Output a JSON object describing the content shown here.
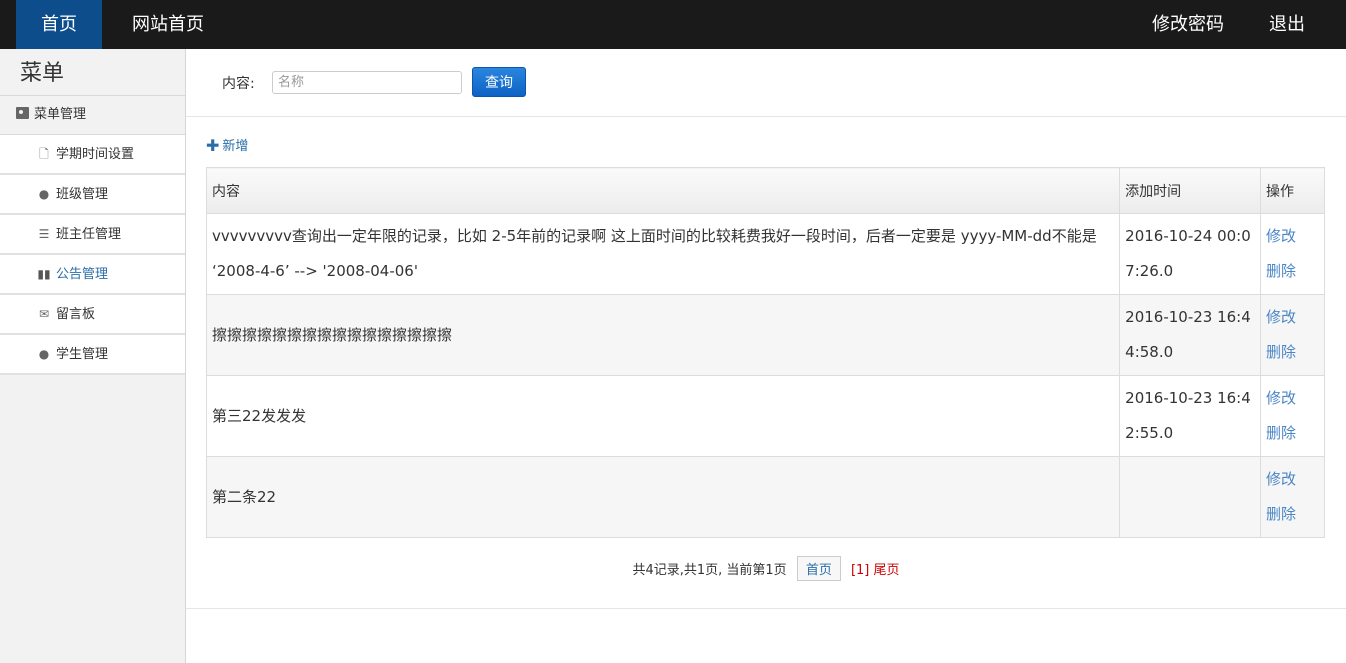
{
  "nav": {
    "home": "首页",
    "site_home": "网站首页",
    "change_password": "修改密码",
    "logout": "退出"
  },
  "sidebar": {
    "title": "菜单",
    "section": "菜单管理",
    "items": [
      {
        "label": "学期时间设置",
        "icon": "file-icon"
      },
      {
        "label": "班级管理",
        "icon": "comment-icon"
      },
      {
        "label": "班主任管理",
        "icon": "list-icon"
      },
      {
        "label": "公告管理",
        "icon": "book-icon",
        "active": true
      },
      {
        "label": "留言板",
        "icon": "envelope-icon"
      },
      {
        "label": "学生管理",
        "icon": "comment-icon"
      }
    ]
  },
  "search": {
    "label": "内容:",
    "placeholder": "名称",
    "value": "",
    "button": "查询"
  },
  "toolbar": {
    "add_label": "新增"
  },
  "table": {
    "headers": [
      "内容",
      "添加时间",
      "操作"
    ],
    "rows": [
      {
        "content": "vvvvvvvvv查询出一定年限的记录，比如 2-5年前的记录啊 这上面时间的比较耗费我好一段时间，后者一定要是 yyyy-MM-dd不能是 ‘2008-4-6’ --> '2008-04-06'",
        "time": "2016-10-24 00:07:26.0"
      },
      {
        "content": "擦擦擦擦擦擦擦擦擦擦擦擦擦擦擦擦",
        "time": "2016-10-23 16:44:58.0"
      },
      {
        "content": "第三22发发发",
        "time": "2016-10-23 16:42:55.0"
      },
      {
        "content": "第二条22",
        "time": ""
      }
    ],
    "edit_label": "修改",
    "delete_label": "删除"
  },
  "pager": {
    "summary": "共4记录,共1页, 当前第1页",
    "first": "首页",
    "current": "[1]",
    "last": "尾页"
  },
  "colors": {
    "topbar": "#1a1a1a",
    "active_nav": "#0d4d8c",
    "link": "#4a86c5",
    "pager_current": "#cc0000"
  }
}
